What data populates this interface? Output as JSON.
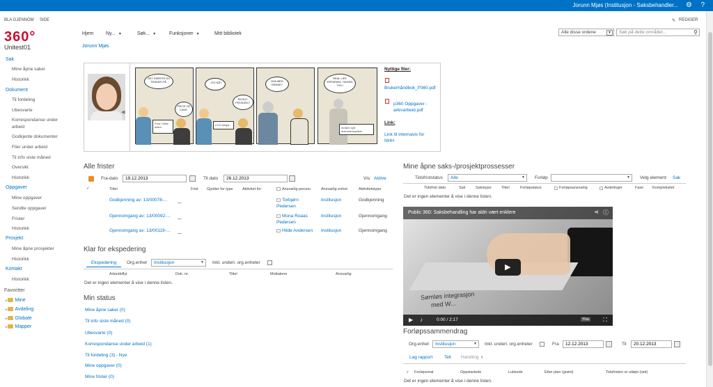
{
  "suitebar": {
    "user": "Jorunn Mjøs (Institusjon - Saksbehandler..."
  },
  "ribbon": {
    "browse": "BLA GJENNOM",
    "page": "SIDE",
    "edit": "REDIGER"
  },
  "logo": {
    "number": "360°",
    "name": "Unitest01"
  },
  "topnav": {
    "items": [
      "Hjem",
      "Ny...",
      "Søk...",
      "Funksjoner",
      "Mitt bibliotek"
    ]
  },
  "search": {
    "scope": "Alle disse ordene",
    "placeholder": "Søk på dette området..."
  },
  "breadcrumb": "Jorunn Mjøs",
  "leftnav": {
    "sak": {
      "label": "Sak",
      "items": [
        "Mine åpne saker",
        "Historikk"
      ]
    },
    "dokument": {
      "label": "Dokument",
      "items": [
        "Til fordeling",
        "Ubesvarte",
        "Korrespondanse under",
        "arbeid",
        "Godkjente dokumenter",
        "Filer under arbeid",
        "Til info siste måned",
        "Oversikt",
        "Historikk"
      ]
    },
    "oppgaver": {
      "label": "Oppgaver",
      "items": [
        "Mine oppgaver",
        "Sendte oppgaver",
        "Frister",
        "Historikk"
      ]
    },
    "prosjekt": {
      "label": "Prosjekt",
      "items": [
        "Mine åpne prosjekter",
        "Historikk"
      ]
    },
    "kontakt": {
      "label": "Kontakt",
      "items": [
        "Historikk"
      ]
    },
    "favoritter": {
      "label": "Favoritter",
      "items": [
        "Mine",
        "Avdeling",
        "Globale",
        "Mapper"
      ]
    }
  },
  "banner": {
    "comic": {
      "b1": "DET FØRSTE DU TENKER PÅ.",
      "b2": "PIECE OF CAKE.",
      "s1": "Fred i Mids østen",
      "b3": "...OG NÅ?",
      "s2": "CO2-fangst",
      "b4": "SKOLE-PROSJEKT.",
      "b5": "HVA MED DENNE?",
      "b6": "REAL LIFE ERFARING. HAGEN TVIL!",
      "s3": "Innføre nytt dokumentsystem"
    },
    "useful_title": "Nyttige filer:",
    "file1": "Brukerhåndbok_P360.pdf",
    "file2": "p360 Oppgaver - arkivarbeid.pdf",
    "link_title": "Link:",
    "link": "Link til internavis for NHH"
  },
  "frister": {
    "title": "Alle frister",
    "fra_label": "Fra-dato",
    "fra": "19.12.2013",
    "til_label": "Til dato",
    "til": "26.12.2013",
    "vis_label": "Vis:",
    "vis": "Aktive",
    "cols": [
      "Tittel",
      "Frist",
      "Gjelder for type",
      "Aktivitet for",
      "Ansvarlig person",
      "Ansvarlig enhet",
      "Aktivitetstype"
    ],
    "rows": [
      {
        "title": "Godkjenning av: 13/00078-...",
        "person": "Torbjørn",
        "person2": "Pedersen",
        "unit": "Institusjon",
        "type": "Godkjenning"
      },
      {
        "title": "Gjennomgang av: 13/00092-...",
        "person": "Mona Roaas",
        "person2": "Pedersen",
        "unit": "Institusjon",
        "type": "Gjennomgang"
      },
      {
        "title": "Gjennomgang av: 13/00119-...",
        "person": "Hilde Andersen",
        "person2": "",
        "unit": "Institusjon",
        "type": "Gjennomgang"
      }
    ]
  },
  "ekspedering": {
    "title": "Klar for ekspedering",
    "link": "Ekspedering",
    "org_label": "Org.enhet",
    "org": "Institusjon",
    "inkl": "Inkl. underl. org.enheter",
    "cols": [
      "Arbeidsflyt",
      "Dok. nr.",
      "Tittel",
      "Mottakere",
      "Ansvarlig"
    ],
    "empty": "Det er ingen elementer å vise i denne listen."
  },
  "status": {
    "title": "Min status",
    "items": [
      "Mine åpne saker (0)",
      "Til info siste måned (0)",
      "Ubesvarte (0)",
      "Korrespondanse under arbeid (1)",
      "Til fordeling (3) - Nye",
      "Mine oppgaver (0)",
      "Mine frister (0)"
    ]
  },
  "prosesser": {
    "title": "Mine åpne saks-/prosjektprossesser",
    "status_label": "Tidsfriststatus",
    "status": "Alle",
    "forlop_label": "Forløp",
    "forlop": "",
    "velg_label": "Velg element:",
    "velg": "Sak",
    "cols": [
      "Tidsfrist dato",
      "Sak",
      "Sakstype",
      "Tittel",
      "Forløpstatus",
      "Forløpsansvarlig",
      "Avdelinger",
      "Fase",
      "Kompleksitet"
    ],
    "empty": "Det er ingen elementer å vise i denne listen."
  },
  "video": {
    "title": "Public 360: Saksbehandling har aldri vært enklere",
    "overlay1": "Sømløs integrasjon",
    "overlay2": "med W...",
    "time": "0:00 / 2:17"
  },
  "forlop": {
    "title": "Forløpssammendrag",
    "org_label": "Org.enhet",
    "org": "Institusjon",
    "inkl": "Inkl. underl. org.enheter",
    "fra_label": "Fra",
    "fra": "12.12.2013",
    "til_label": "Til",
    "til": "20.12.2013",
    "tab1": "Lag rapport",
    "tab2": "Tell",
    "tab3": "Handling",
    "cols": [
      "Forløpsmal",
      "Oppstartede",
      "Lukkede",
      "Etter plan (grønt)",
      "Tidsfristen er utløpt (rød)"
    ],
    "empty": "Det er ingen elementer å vise i denne listen."
  }
}
